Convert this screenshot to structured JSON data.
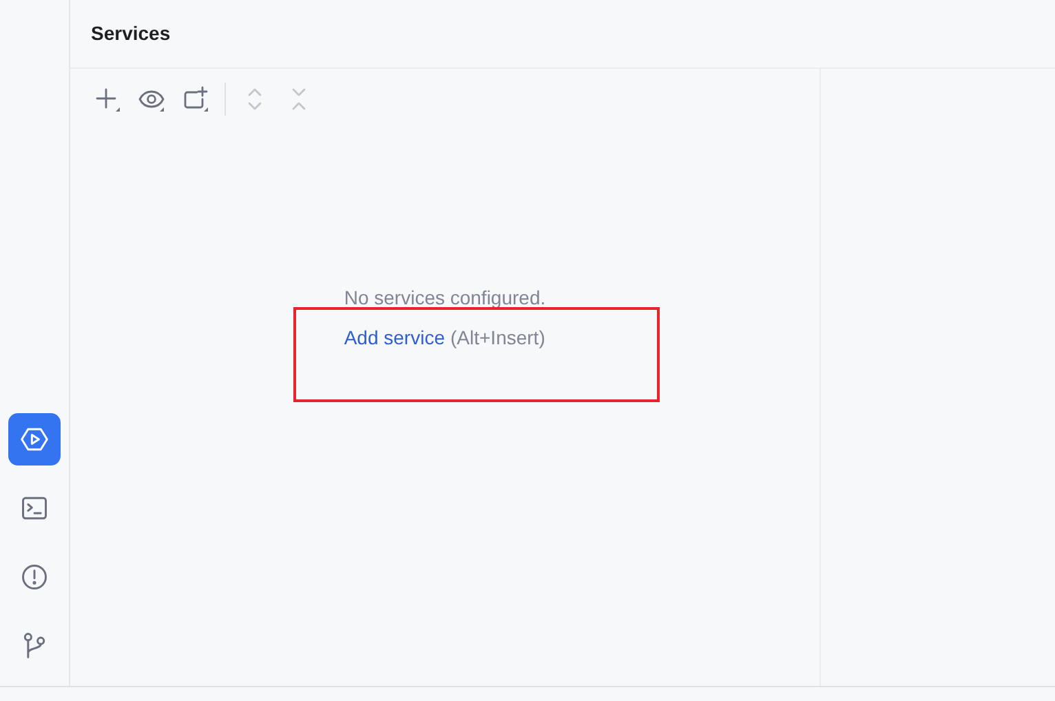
{
  "tool_windows": [
    {
      "kind": "services",
      "selected": true
    },
    {
      "kind": "terminal",
      "selected": false
    },
    {
      "kind": "problems",
      "selected": false
    },
    {
      "kind": "git",
      "selected": false
    }
  ],
  "panel": {
    "title": "Services"
  },
  "toolbar": [
    {
      "kind": "add",
      "disabled": false
    },
    {
      "kind": "view",
      "disabled": false
    },
    {
      "kind": "new-group",
      "disabled": false
    },
    {
      "kind": "separator"
    },
    {
      "kind": "expand",
      "disabled": true
    },
    {
      "kind": "collapse",
      "disabled": true
    }
  ],
  "empty_state": {
    "message": "No services configured.",
    "link": "Add service",
    "shortcut": "(Alt+Insert)"
  },
  "annotation": {
    "kind": "highlight-box",
    "color": "#e8232c"
  }
}
